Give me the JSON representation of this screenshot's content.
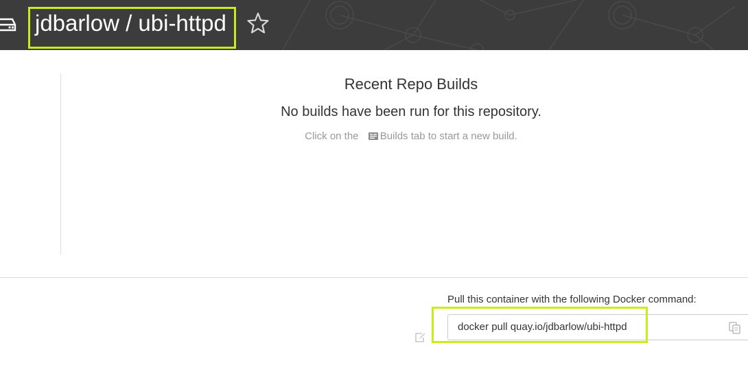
{
  "header": {
    "repo_title": "jdbarlow / ubi-httpd",
    "background_color": "#3c3c3c",
    "highlight_color": "#c8ee16",
    "repo_icon": "repository-icon",
    "star_icon": "star-icon"
  },
  "builds": {
    "title": "Recent Repo Builds",
    "empty_message": "No builds have been run for this repository.",
    "hint_prefix": "Click on the",
    "hint_tab_icon": "builds-tab-icon",
    "hint_suffix": "Builds tab to start a new build."
  },
  "pull": {
    "label": "Pull this container with the following Docker command:",
    "command": "docker pull quay.io/jdbarlow/ubi-httpd",
    "copy_icon": "copy-icon",
    "edit_icon": "edit-icon"
  }
}
